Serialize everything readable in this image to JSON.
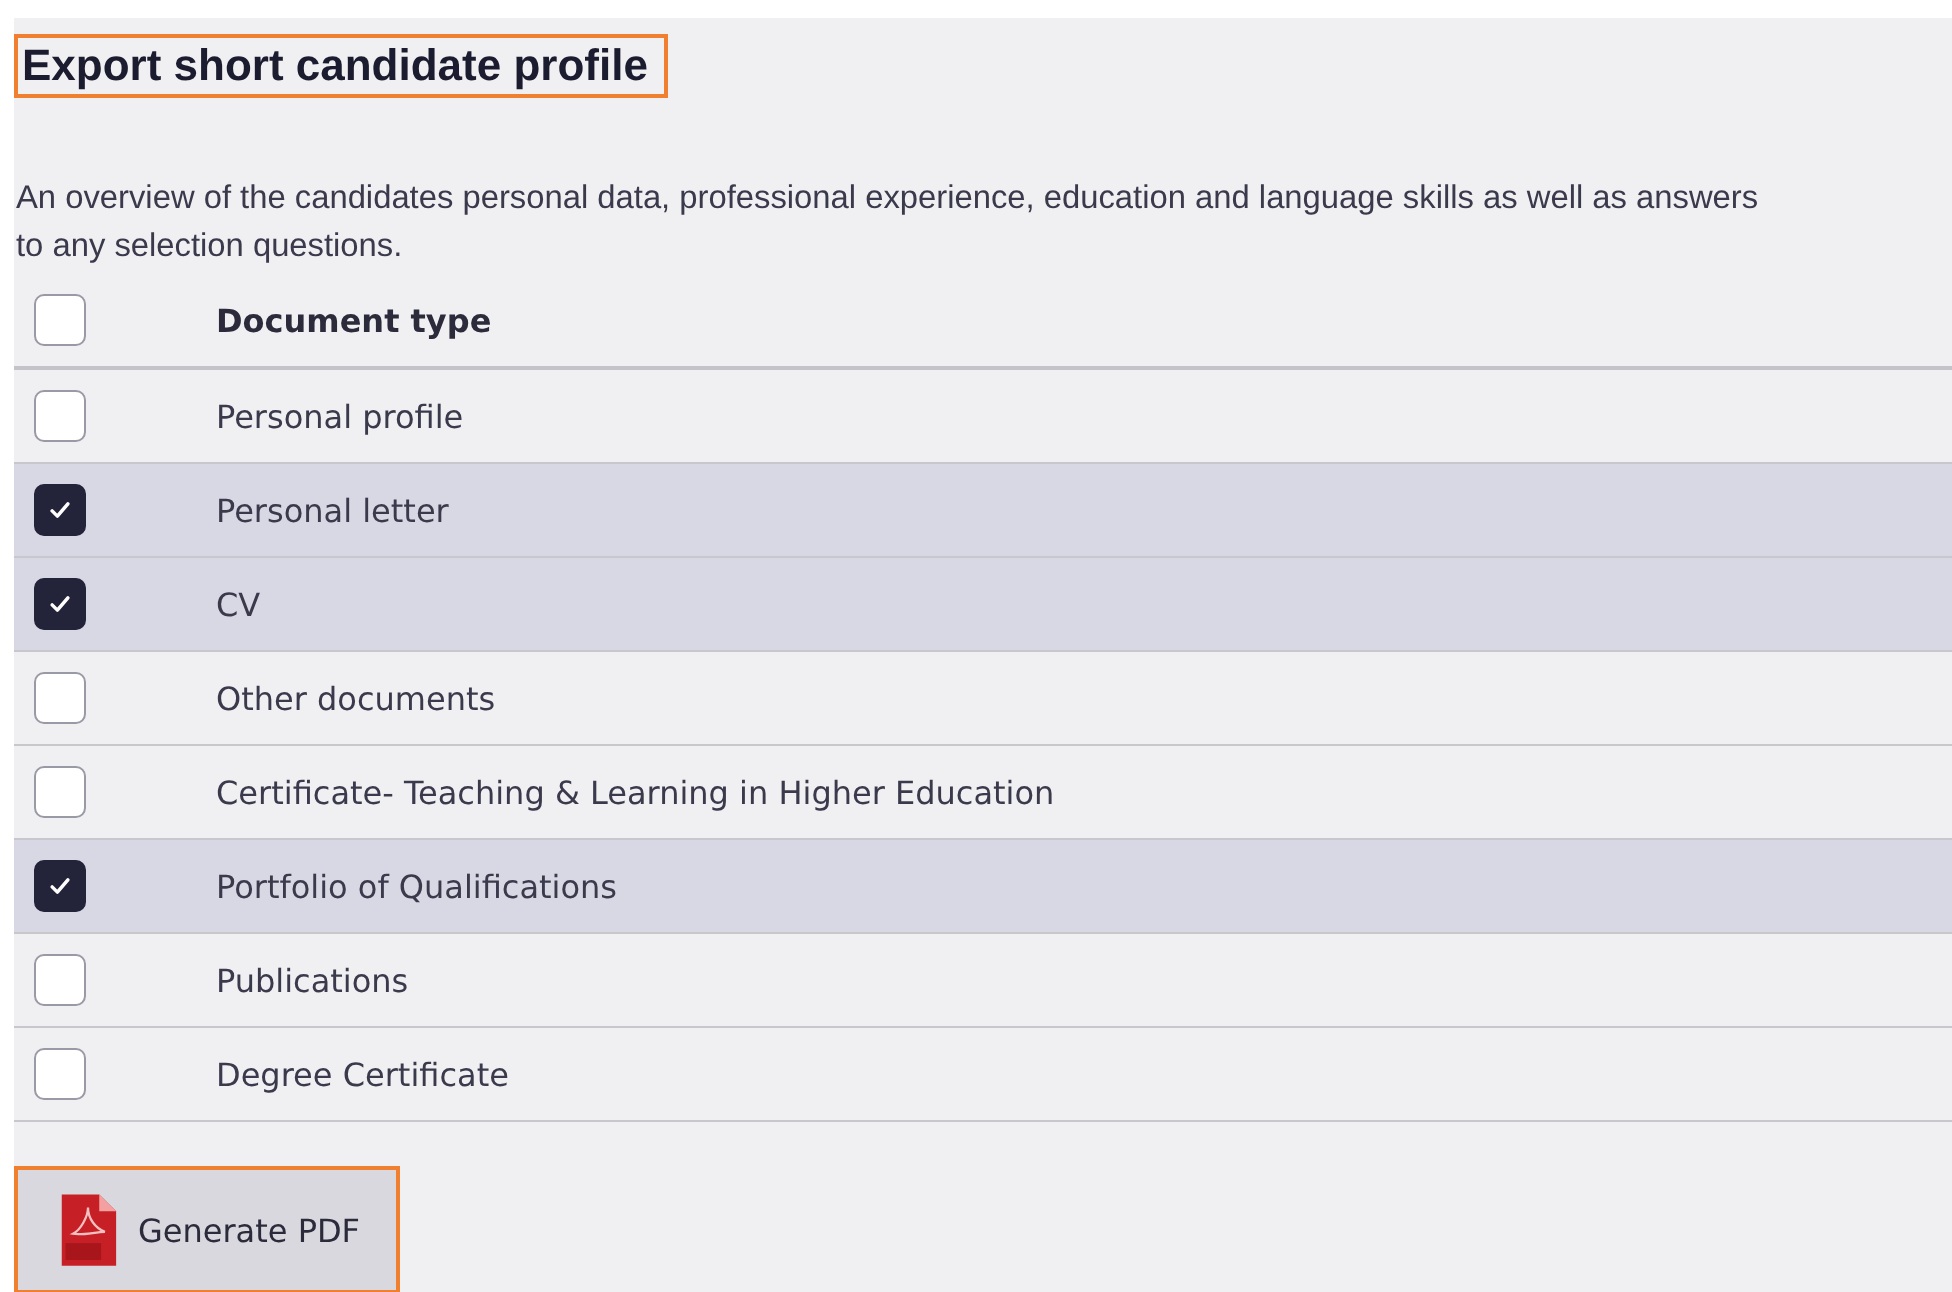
{
  "title": "Export short candidate profile",
  "description": "An overview of the candidates personal data, professional experience, education and language skills as well as answers\nto any selection questions.",
  "table": {
    "header": {
      "label": "Document type",
      "checked": false
    },
    "rows": [
      {
        "label": "Personal profile",
        "checked": false
      },
      {
        "label": "Personal letter",
        "checked": true
      },
      {
        "label": "CV",
        "checked": true
      },
      {
        "label": "Other documents",
        "checked": false
      },
      {
        "label": "Certificate- Teaching & Learning in Higher Education",
        "checked": false
      },
      {
        "label": "Portfolio of Qualifications",
        "checked": true
      },
      {
        "label": "Publications",
        "checked": false
      },
      {
        "label": "Degree Certificate",
        "checked": false
      }
    ]
  },
  "button": {
    "label": "Generate PDF"
  }
}
